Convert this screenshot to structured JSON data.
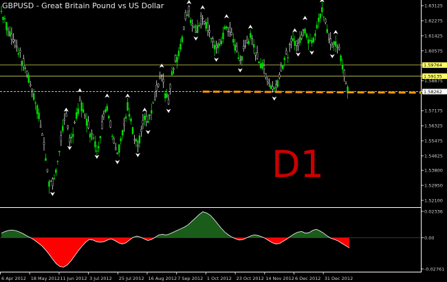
{
  "header": {
    "title": "GBPUSD - Great Britain Pound vs US Dollar"
  },
  "overlay_label": "D1",
  "colors": {
    "background": "#000000",
    "bull_candle": "#00e000",
    "bear_candle": "#e8e8e8",
    "support_line": "#ff9900",
    "overlay_label": "#cc0000",
    "indicator_positive": "#1a5c1a",
    "indicator_negative": "#ff0000",
    "axis_text": "#d0d0d0",
    "price_tag_yellow": "#ffff66",
    "price_tag_white": "#ffffff",
    "grid_line": "#6a6a6a"
  },
  "chart_data": [
    {
      "type": "candlestick",
      "title": "GBPUSD - Great Britain Pound vs US Dollar",
      "timeframe": "D1",
      "ylim": [
        1.5175,
        1.6345
      ],
      "y_ticks": [
        "1.63125",
        "1.62275",
        "1.61425",
        "1.60575",
        "1.59764",
        "1.59135",
        "1.58875",
        "1.58262",
        "1.57175",
        "1.56325",
        "1.55475",
        "1.54625",
        "1.53800",
        "1.52950",
        "1.52100"
      ],
      "highlighted_levels": [
        {
          "label": "1.59764",
          "value": 1.59764,
          "style": "yellow"
        },
        {
          "label": "1.59135",
          "value": 1.59135,
          "style": "yellow"
        },
        {
          "label": "1.58262",
          "value": 1.58262,
          "style": "white"
        }
      ],
      "x_ticks": [
        "6 Apr 2012",
        "18 May 2012",
        "11 Jun 2012",
        "3 Jul 2012",
        "25 Jul 2012",
        "16 Aug 2012",
        "7 Sep 2012",
        "1 Oct 2012",
        "23 Oct 2012",
        "14 Nov 2012",
        "6 Dec 2012",
        "31 Dec 2012"
      ],
      "support_level": 1.5826,
      "close_path": [
        [
          0,
          1.628
        ],
        [
          2,
          1.624
        ],
        [
          4,
          1.617
        ],
        [
          6,
          1.614
        ],
        [
          8,
          1.61
        ],
        [
          10,
          1.606
        ],
        [
          12,
          1.6
        ],
        [
          14,
          1.596
        ],
        [
          16,
          1.59
        ],
        [
          18,
          1.584
        ],
        [
          20,
          1.577
        ],
        [
          22,
          1.569
        ],
        [
          24,
          1.558
        ],
        [
          26,
          1.546
        ],
        [
          28,
          1.532
        ],
        [
          30,
          1.53
        ],
        [
          32,
          1.537
        ],
        [
          34,
          1.55
        ],
        [
          36,
          1.562
        ],
        [
          38,
          1.567
        ],
        [
          40,
          1.556
        ],
        [
          42,
          1.559
        ],
        [
          44,
          1.569
        ],
        [
          46,
          1.578
        ],
        [
          48,
          1.571
        ],
        [
          50,
          1.566
        ],
        [
          52,
          1.56
        ],
        [
          54,
          1.555
        ],
        [
          56,
          1.551
        ],
        [
          58,
          1.556
        ],
        [
          60,
          1.57
        ],
        [
          62,
          1.575
        ],
        [
          64,
          1.564
        ],
        [
          66,
          1.555
        ],
        [
          68,
          1.548
        ],
        [
          70,
          1.555
        ],
        [
          72,
          1.563
        ],
        [
          74,
          1.575
        ],
        [
          76,
          1.568
        ],
        [
          78,
          1.556
        ],
        [
          80,
          1.552
        ],
        [
          82,
          1.56
        ],
        [
          84,
          1.567
        ],
        [
          86,
          1.565
        ],
        [
          88,
          1.57
        ],
        [
          90,
          1.58
        ],
        [
          92,
          1.586
        ],
        [
          94,
          1.592
        ],
        [
          96,
          1.582
        ],
        [
          98,
          1.577
        ],
        [
          100,
          1.594
        ],
        [
          102,
          1.6
        ],
        [
          104,
          1.605
        ],
        [
          106,
          1.612
        ],
        [
          108,
          1.625
        ],
        [
          110,
          1.628
        ],
        [
          112,
          1.621
        ],
        [
          114,
          1.618
        ],
        [
          116,
          1.62
        ],
        [
          118,
          1.625
        ],
        [
          120,
          1.621
        ],
        [
          122,
          1.617
        ],
        [
          124,
          1.611
        ],
        [
          126,
          1.606
        ],
        [
          128,
          1.61
        ],
        [
          130,
          1.615
        ],
        [
          132,
          1.62
        ],
        [
          134,
          1.616
        ],
        [
          136,
          1.612
        ],
        [
          138,
          1.605
        ],
        [
          140,
          1.6
        ],
        [
          142,
          1.606
        ],
        [
          144,
          1.611
        ],
        [
          146,
          1.614
        ],
        [
          148,
          1.608
        ],
        [
          150,
          1.602
        ],
        [
          152,
          1.599
        ],
        [
          154,
          1.595
        ],
        [
          156,
          1.59
        ],
        [
          158,
          1.586
        ],
        [
          160,
          1.584
        ],
        [
          162,
          1.589
        ],
        [
          164,
          1.596
        ],
        [
          166,
          1.601
        ],
        [
          168,
          1.604
        ],
        [
          170,
          1.61
        ],
        [
          172,
          1.612
        ],
        [
          174,
          1.609
        ],
        [
          176,
          1.614
        ],
        [
          178,
          1.619
        ],
        [
          180,
          1.613
        ],
        [
          182,
          1.61
        ],
        [
          184,
          1.617
        ],
        [
          186,
          1.625
        ],
        [
          188,
          1.629
        ],
        [
          190,
          1.621
        ],
        [
          192,
          1.613
        ],
        [
          194,
          1.608
        ],
        [
          196,
          1.611
        ],
        [
          198,
          1.606
        ],
        [
          200,
          1.598
        ],
        [
          202,
          1.588
        ],
        [
          204,
          1.583
        ]
      ]
    },
    {
      "type": "area",
      "title": "",
      "ylim": [
        -0.02761,
        0.02336
      ],
      "y_ticks": [
        "0.02336",
        "0.00",
        "-0.02761"
      ],
      "zero_line": 0,
      "values": [
        0.004,
        0.0055,
        0.0065,
        0.0068,
        0.0062,
        0.005,
        0.0035,
        0.0015,
        0.0,
        -0.002,
        -0.0045,
        -0.007,
        -0.0105,
        -0.0145,
        -0.019,
        -0.023,
        -0.0255,
        -0.026,
        -0.024,
        -0.0205,
        -0.016,
        -0.0115,
        -0.0075,
        -0.004,
        -0.0015,
        -0.002,
        -0.0035,
        -0.004,
        -0.0035,
        -0.002,
        -0.001,
        -0.0025,
        -0.0045,
        -0.0055,
        -0.0045,
        -0.002,
        0.0005,
        0.0015,
        0.0005,
        -0.001,
        -0.0025,
        -0.0015,
        0.0005,
        0.0025,
        0.003,
        0.0025,
        0.0035,
        0.005,
        0.0065,
        0.008,
        0.0095,
        0.0115,
        0.0145,
        0.0175,
        0.0205,
        0.023,
        0.022,
        0.02,
        0.0165,
        0.0125,
        0.0085,
        0.005,
        0.0025,
        0.0005,
        -0.001,
        -0.002,
        -0.0015,
        0.0,
        0.0015,
        0.0025,
        0.002,
        0.001,
        -0.0005,
        -0.0025,
        -0.0045,
        -0.0055,
        -0.005,
        -0.003,
        -0.001,
        0.0015,
        0.0035,
        0.005,
        0.0055,
        0.004,
        0.0045,
        0.0065,
        0.0075,
        0.006,
        0.004,
        0.0015,
        -0.0005,
        -0.0015,
        -0.003,
        -0.005,
        -0.007,
        -0.009
      ]
    }
  ]
}
